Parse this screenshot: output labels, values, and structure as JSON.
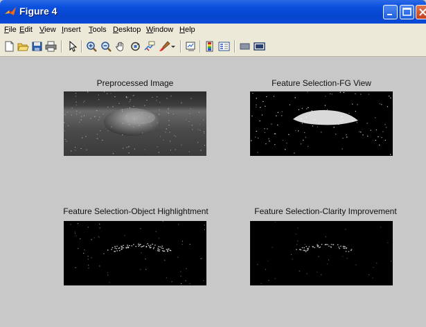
{
  "window": {
    "title": "Figure 4"
  },
  "menu": [
    "File",
    "Edit",
    "View",
    "Insert",
    "Tools",
    "Desktop",
    "Window",
    "Help"
  ],
  "toolbar": [
    "new-figure-icon",
    "open-file-icon",
    "save-icon",
    "print-icon",
    "pointer-icon",
    "zoom-in-icon",
    "zoom-out-icon",
    "pan-icon",
    "rotate-3d-icon",
    "data-cursor-icon",
    "brush-icon",
    "link-plot-icon",
    "colorbar-icon",
    "legend-icon",
    "hide-plot-tools-icon",
    "show-plot-tools-icon"
  ],
  "axes": {
    "top_left": {
      "title": "Preprocessed Image"
    },
    "top_right": {
      "title": "Feature Selection-FG View"
    },
    "bottom_left": {
      "title": "Feature Selection-Object Highlightment"
    },
    "bottom_right": {
      "title": "Feature Selection-Clarity Improvement"
    }
  },
  "colors": {
    "titlebar": "#0a4ad8",
    "figure_bg": "#c8c8c8",
    "menubar_bg": "#ece9d8",
    "close_button": "#c6401c"
  }
}
